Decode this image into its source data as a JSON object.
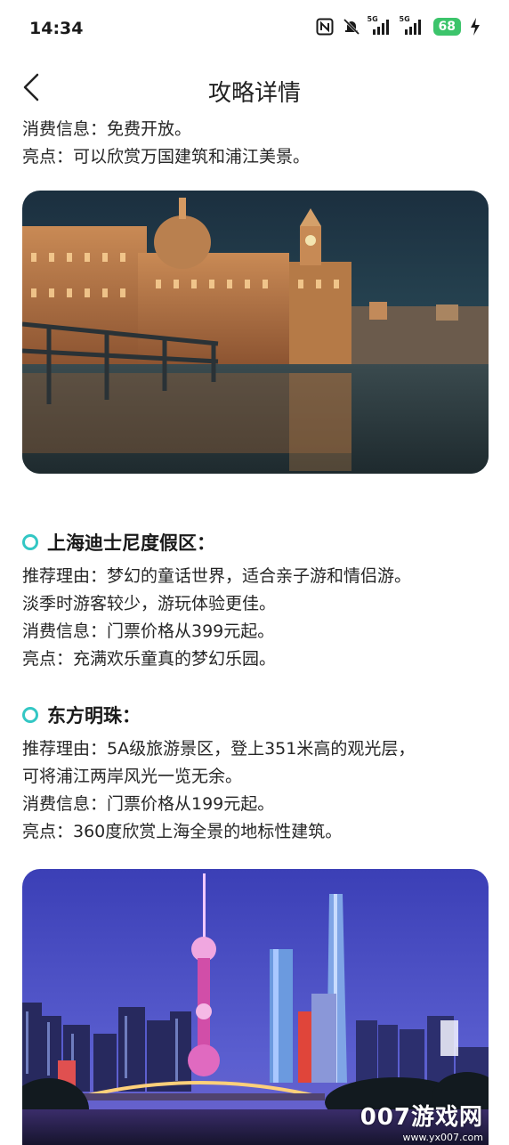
{
  "status": {
    "time": "14:34",
    "network1": "5G",
    "network2": "5G",
    "battery": "68"
  },
  "header": {
    "title": "攻略详情"
  },
  "intro": {
    "line1": "消费信息：免费开放。",
    "line2": "亮点：可以欣赏万国建筑和浦江美景。"
  },
  "disney": {
    "title": "上海迪士尼度假区：",
    "lines": [
      "推荐理由：梦幻的童话世界，适合亲子游和情侣游。",
      "淡季时游客较少，游玩体验更佳。",
      "消费信息：门票价格从399元起。",
      "亮点：充满欢乐童真的梦幻乐园。"
    ]
  },
  "pearl": {
    "title": "东方明珠：",
    "lines": [
      "推荐理由：5A级旅游景区，登上351米高的观光层，",
      "可将浦江两岸风光一览无余。",
      "消费信息：门票价格从199元起。",
      "亮点：360度欣赏上海全景的地标性建筑。"
    ]
  },
  "watermark": {
    "brand": "007游戏网",
    "url": "www.yx007.com"
  },
  "colors": {
    "accent": "#33c7c4",
    "battery": "#3cc46b"
  }
}
